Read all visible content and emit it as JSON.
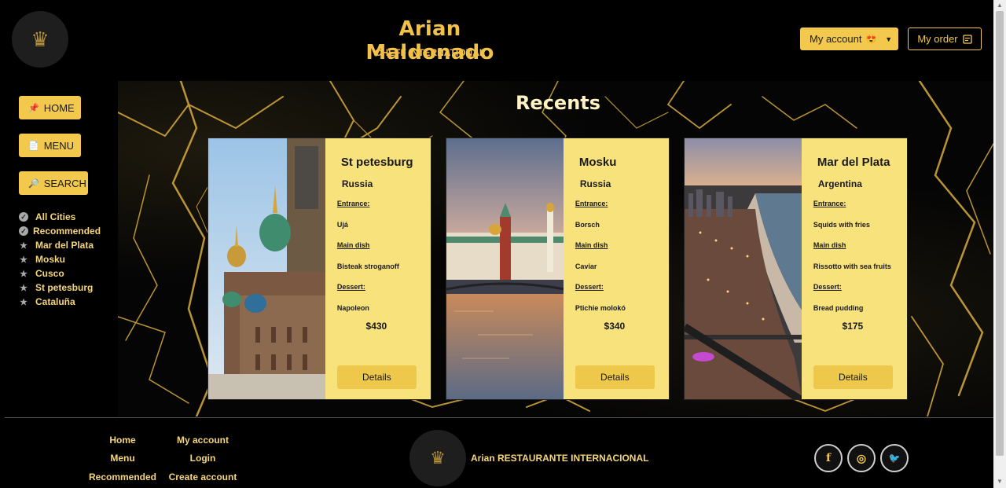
{
  "header": {
    "logo_icon": "chef-logo-icon",
    "title": "Arian Maldonado",
    "subtitle": "CHEFF INTERNATIONAL",
    "account_label": "My account",
    "account_emoji": "😍",
    "order_label": "My order"
  },
  "sidebar": {
    "buttons": [
      {
        "icon": "📌",
        "label": "HOME"
      },
      {
        "icon": "📄",
        "label": "MENU"
      },
      {
        "icon": "🔎",
        "label": "SEARCH"
      }
    ],
    "cities": [
      {
        "label": "All Cities",
        "icon": "check-circle-icon"
      },
      {
        "label": "Recommended",
        "icon": "check-circle-icon"
      },
      {
        "label": "Mar del Plata",
        "icon": "star-icon"
      },
      {
        "label": "Mosku",
        "icon": "star-icon"
      },
      {
        "label": "Cusco",
        "icon": "star-icon"
      },
      {
        "label": "St petesburg",
        "icon": "star-icon"
      },
      {
        "label": "Cataluña",
        "icon": "star-icon"
      }
    ]
  },
  "main": {
    "title": "Recents",
    "cards": [
      {
        "city": "St petesburg",
        "country": "Russia",
        "entrance_label": "Entrance:",
        "entrance": "Ujá",
        "main_label": "Main dish",
        "main": "Bisteak stroganoff",
        "dessert_label": "Dessert:",
        "dessert": "Napoleon",
        "price": "$430",
        "button": "Details"
      },
      {
        "city": "Mosku",
        "country": "Russia",
        "entrance_label": "Entrance:",
        "entrance": "Borsch",
        "main_label": "Main dish",
        "main": "Caviar",
        "dessert_label": "Dessert:",
        "dessert": "Ptichie molokó",
        "price": "$340",
        "button": "Details"
      },
      {
        "city": "Mar del Plata",
        "country": "Argentina",
        "entrance_label": "Entrance:",
        "entrance": "Squids with fries",
        "main_label": "Main dish",
        "main": "Rissotto with sea fruits",
        "dessert_label": "Dessert:",
        "dessert": "Bread pudding",
        "price": "$175",
        "button": "Details"
      }
    ]
  },
  "footer": {
    "links_col1": [
      "Home",
      "Menu",
      "Recommended"
    ],
    "links_col2": [
      "My account",
      "Login",
      "Create account"
    ],
    "brand": "Arian RESTAURANTE INTERNACIONAL",
    "social": [
      {
        "icon": "facebook-icon",
        "glyph": "f"
      },
      {
        "icon": "instagram-icon",
        "glyph": "◎"
      },
      {
        "icon": "twitter-icon",
        "glyph": "🐦"
      }
    ]
  },
  "colors": {
    "accent": "#f2c94c",
    "card_bg": "#f8e27c",
    "background": "#000000"
  }
}
